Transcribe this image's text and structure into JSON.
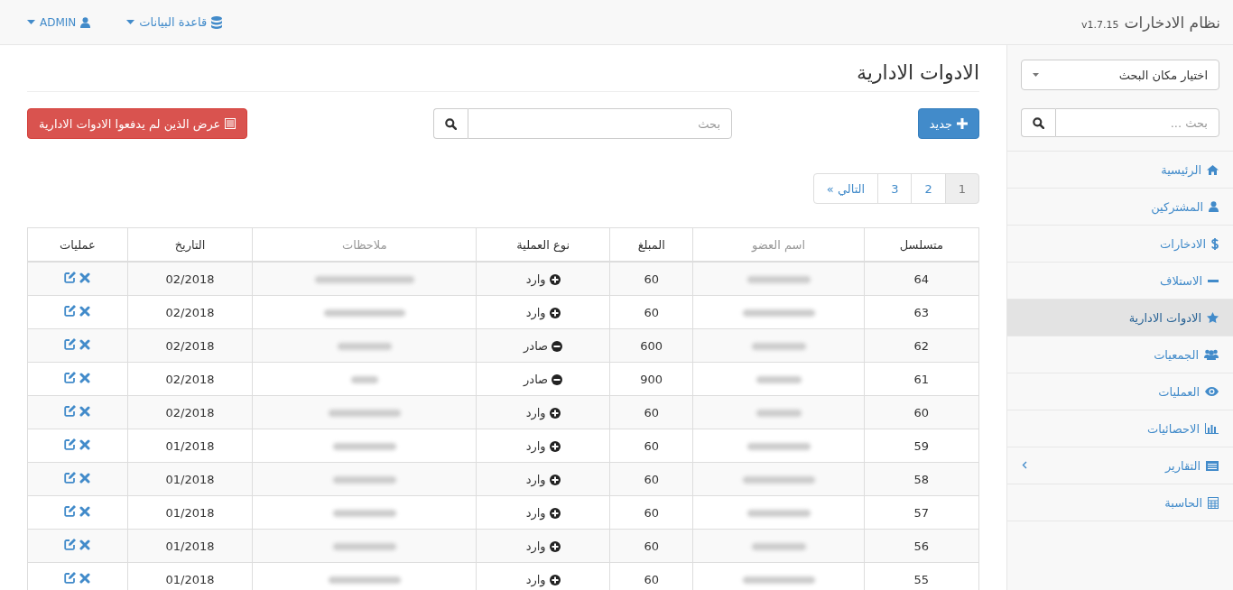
{
  "navbar": {
    "brand": "نظام الادخارات",
    "version": "v1.7.15",
    "database_menu": "قاعدة البيانات",
    "user_menu": "ADMIN"
  },
  "sidebar": {
    "search_scope": "اختيار مكان البحث",
    "search": {
      "placeholder": "بحث ..."
    },
    "items": [
      {
        "label": "الرئيسية",
        "selected": false
      },
      {
        "label": "المشتركين",
        "selected": false
      },
      {
        "label": "الادخارات",
        "selected": false
      },
      {
        "label": "الاستلاف",
        "selected": false
      },
      {
        "label": "الادوات الادارية",
        "selected": true
      },
      {
        "label": "الجمعيات",
        "selected": false
      },
      {
        "label": "العمليات",
        "selected": false
      },
      {
        "label": "الاحصائيات",
        "selected": false
      },
      {
        "label": "التقارير",
        "selected": false,
        "has_submenu": true
      },
      {
        "label": "الحاسبة",
        "selected": false
      }
    ]
  },
  "page": {
    "title": "الادوات الادارية",
    "new_button": "جديد",
    "search": {
      "placeholder": "بحث"
    },
    "unpaid_button": "عرض الذين لم يدفعوا الادوات الادارية"
  },
  "pagination": [
    {
      "label": "1",
      "selected": true
    },
    {
      "label": "2",
      "selected": false
    },
    {
      "label": "3",
      "selected": false
    },
    {
      "label": "التالي »",
      "selected": false
    }
  ],
  "table": {
    "columns": [
      "متسلسل",
      "اسم العضو",
      "المبلغ",
      "نوع العملية",
      "ملاحظات",
      "التاريخ",
      "عمليات"
    ],
    "rows": [
      {
        "serial": "64",
        "amount": "60",
        "type": "وارد",
        "kind": "in",
        "date": "02/2018"
      },
      {
        "serial": "63",
        "amount": "60",
        "type": "وارد",
        "kind": "in",
        "date": "02/2018"
      },
      {
        "serial": "62",
        "amount": "600",
        "type": "صادر",
        "kind": "out",
        "date": "02/2018"
      },
      {
        "serial": "61",
        "amount": "900",
        "type": "صادر",
        "kind": "out",
        "date": "02/2018"
      },
      {
        "serial": "60",
        "amount": "60",
        "type": "وارد",
        "kind": "in",
        "date": "02/2018"
      },
      {
        "serial": "59",
        "amount": "60",
        "type": "وارد",
        "kind": "in",
        "date": "01/2018"
      },
      {
        "serial": "58",
        "amount": "60",
        "type": "وارد",
        "kind": "in",
        "date": "01/2018"
      },
      {
        "serial": "57",
        "amount": "60",
        "type": "وارد",
        "kind": "in",
        "date": "01/2018"
      },
      {
        "serial": "56",
        "amount": "60",
        "type": "وارد",
        "kind": "in",
        "date": "01/2018"
      },
      {
        "serial": "55",
        "amount": "60",
        "type": "وارد",
        "kind": "in",
        "date": "01/2018"
      }
    ]
  }
}
